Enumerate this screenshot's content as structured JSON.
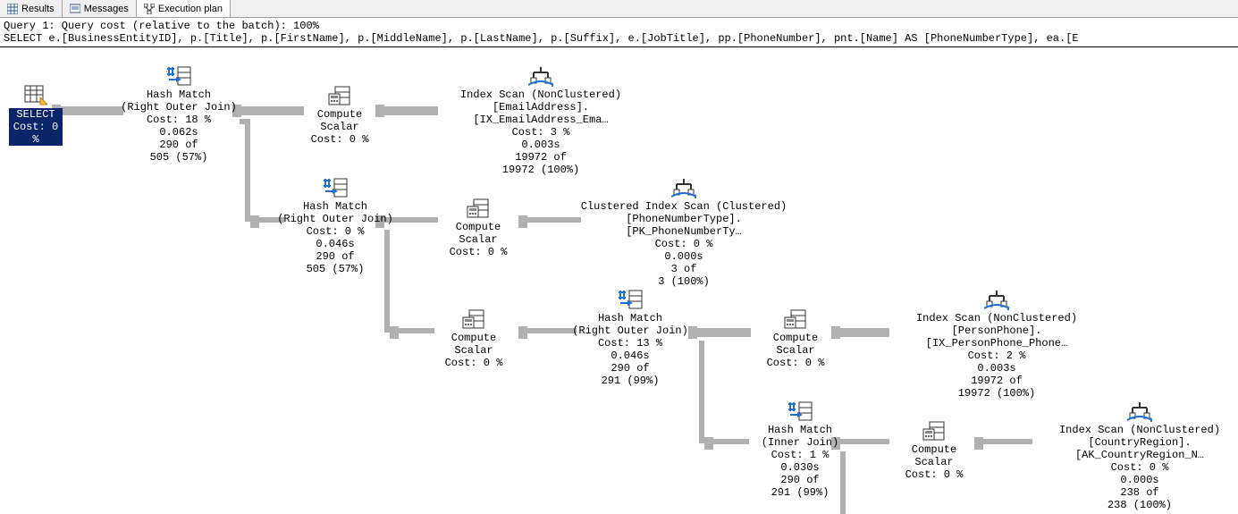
{
  "tabs": {
    "results": "Results",
    "messages": "Messages",
    "plan": "Execution plan"
  },
  "query_header": "Query 1: Query cost (relative to the batch): 100%",
  "query_sql": "SELECT e.[BusinessEntityID], p.[Title], p.[FirstName], p.[MiddleName], p.[LastName], p.[Suffix], e.[JobTitle], pp.[PhoneNumber], pnt.[Name] AS [PhoneNumberType], ea.[E",
  "nodes": {
    "select": {
      "l1": "SELECT",
      "l2": "Cost: 0 %"
    },
    "hm1": {
      "l1": "Hash Match",
      "l2": "(Right Outer Join)",
      "l3": "Cost: 18 %",
      "l4": "0.062s",
      "l5": "290 of",
      "l6": "505 (57%)"
    },
    "cs1": {
      "l1": "Compute Scalar",
      "l2": "Cost: 0 %"
    },
    "ix1": {
      "l1": "Index Scan (NonClustered)",
      "l2": "[EmailAddress].[IX_EmailAddress_Ema…",
      "l3": "Cost: 3 %",
      "l4": "0.003s",
      "l5": "19972 of",
      "l6": "19972 (100%)"
    },
    "hm2": {
      "l1": "Hash Match",
      "l2": "(Right Outer Join)",
      "l3": "Cost: 0 %",
      "l4": "0.046s",
      "l5": "290 of",
      "l6": "505 (57%)"
    },
    "cs2": {
      "l1": "Compute Scalar",
      "l2": "Cost: 0 %"
    },
    "ix2": {
      "l1": "Clustered Index Scan (Clustered)",
      "l2": "[PhoneNumberType].[PK_PhoneNumberTy…",
      "l3": "Cost: 0 %",
      "l4": "0.000s",
      "l5": "3 of",
      "l6": "3 (100%)"
    },
    "cs3": {
      "l1": "Compute Scalar",
      "l2": "Cost: 0 %"
    },
    "hm3": {
      "l1": "Hash Match",
      "l2": "(Right Outer Join)",
      "l3": "Cost: 13 %",
      "l4": "0.046s",
      "l5": "290 of",
      "l6": "291 (99%)"
    },
    "cs4": {
      "l1": "Compute Scalar",
      "l2": "Cost: 0 %"
    },
    "ix3": {
      "l1": "Index Scan (NonClustered)",
      "l2": "[PersonPhone].[IX_PersonPhone_Phone…",
      "l3": "Cost: 2 %",
      "l4": "0.003s",
      "l5": "19972 of",
      "l6": "19972 (100%)"
    },
    "hm4": {
      "l1": "Hash Match",
      "l2": "(Inner Join)",
      "l3": "Cost: 1 %",
      "l4": "0.030s",
      "l5": "290 of",
      "l6": "291 (99%)"
    },
    "cs5": {
      "l1": "Compute Scalar",
      "l2": "Cost: 0 %"
    },
    "ix4": {
      "l1": "Index Scan (NonClustered)",
      "l2": "[CountryRegion].[AK_CountryRegion_N…",
      "l3": "Cost: 0 %",
      "l4": "0.000s",
      "l5": "238 of",
      "l6": "238 (100%)"
    }
  }
}
